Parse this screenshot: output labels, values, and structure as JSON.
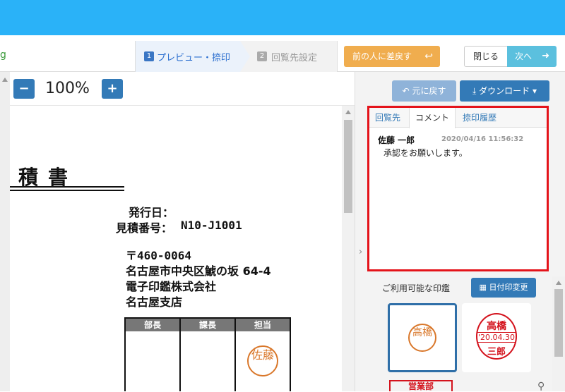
{
  "toolbar": {
    "brand_stub": "g",
    "steps": [
      {
        "num": "1",
        "label": "プレビュー・捺印"
      },
      {
        "num": "2",
        "label": "回覧先設定"
      }
    ],
    "send_back_label": "前の人に差戻す",
    "send_back_icon": "↩",
    "close_label": "閉じる",
    "next_label": "次へ",
    "next_icon": "➜"
  },
  "zoom": {
    "minus": "−",
    "plus": "+",
    "level": "100%"
  },
  "document": {
    "title": "見積書",
    "issue_date_label": "発行日：",
    "estimate_no_label": "見積番号：",
    "estimate_no": "N10-J1001",
    "postal": "〒460-0064",
    "address": "名古屋市中央区鯱の坂 64-4",
    "company": "電子印鑑株式会社",
    "branch": "名古屋支店",
    "stamp_headers": [
      "部長",
      "課長",
      "担当"
    ],
    "seal_text": "佐藤"
  },
  "panel": {
    "undo_label": "元に戻す",
    "undo_icon": "↶",
    "download_label": "ダウンロード",
    "download_icon": "⤓",
    "collapse_icon": "›",
    "tabs": [
      "回覧先",
      "コメント",
      "捺印履歴"
    ],
    "comments": [
      {
        "author": "佐藤 一郎",
        "time": "2020/04/16 11:56:32",
        "body": "承認をお願いします。"
      }
    ],
    "available_seals_label": "ご利用可能な印鑑",
    "date_change_label": "日付印変更",
    "seals": [
      {
        "text": "高橋"
      },
      {
        "top": "高橋",
        "date": "'20.04.30",
        "bottom": "三郎"
      },
      {
        "text": "営業部"
      }
    ]
  },
  "colors": {
    "header": "#2ab2f8",
    "primary": "#337ab7",
    "warning": "#f0ad4e",
    "info": "#5bc0de",
    "highlight": "#e4131a",
    "seal_orange": "#d9772a",
    "seal_red": "#d4131d"
  }
}
